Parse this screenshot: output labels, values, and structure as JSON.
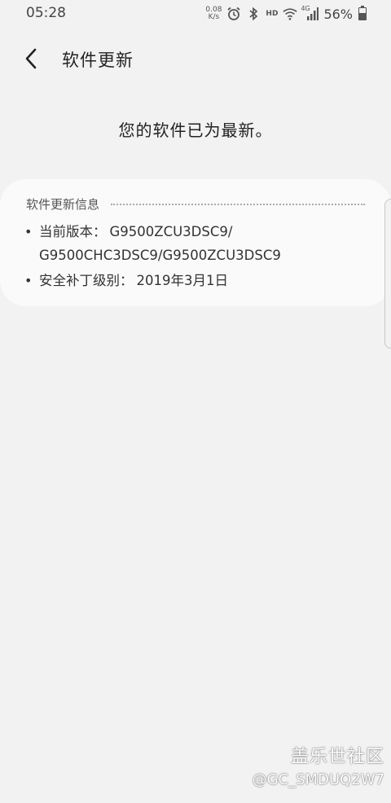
{
  "status_bar": {
    "time": "05:28",
    "net_speed_value": "0.08",
    "net_speed_unit": "K/s",
    "hd_label": "HD",
    "network_label": "4G",
    "battery_percent": "56%",
    "battery_level": 0.56
  },
  "header": {
    "title": "软件更新"
  },
  "main": {
    "status_message": "您的软件已为最新。"
  },
  "info_card": {
    "title": "软件更新信息",
    "items": [
      {
        "label": "当前版本：",
        "value": "G9500ZCU3DSC9/ G9500CHC3DSC9/G9500ZCU3DSC9"
      },
      {
        "label": "安全补丁级别：",
        "value": "2019年3月1日"
      }
    ]
  },
  "watermark": {
    "logo": "盖乐世社区",
    "handle": "@GC_SMDUQ2W7"
  }
}
